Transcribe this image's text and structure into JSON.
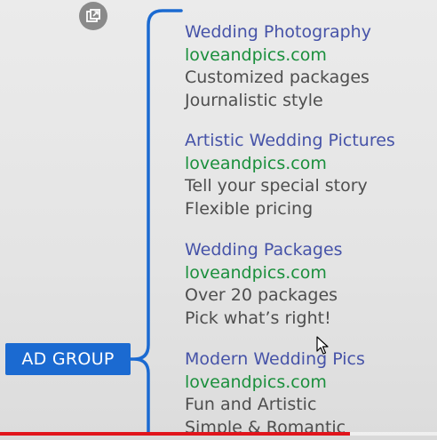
{
  "overlay": {
    "popout_icon": "external-window-icon"
  },
  "diagram": {
    "node_label": "AD GROUP",
    "ads": [
      {
        "headline": "Wedding Photography",
        "url": "loveandpics.com",
        "desc1": "Customized packages",
        "desc2": "Journalistic style"
      },
      {
        "headline": "Artistic Wedding Pictures",
        "url": "loveandpics.com",
        "desc1": "Tell your special story",
        "desc2": "Flexible pricing"
      },
      {
        "headline": "Wedding Packages",
        "url": "loveandpics.com",
        "desc1": "Over 20 packages",
        "desc2": "Pick what’s right!"
      },
      {
        "headline": "Modern Wedding Pics",
        "url": "loveandpics.com",
        "desc1": "Fun and Artistic",
        "desc2": "Simple & Romantic"
      }
    ],
    "colors": {
      "node": "#1b6ad1",
      "connector": "#1b6ad1",
      "headline": "#4653a8",
      "url": "#1a8f3c",
      "description": "#4e4e4e"
    }
  },
  "player": {
    "progress_fraction": 0.8,
    "progress_color": "#e1141b"
  }
}
